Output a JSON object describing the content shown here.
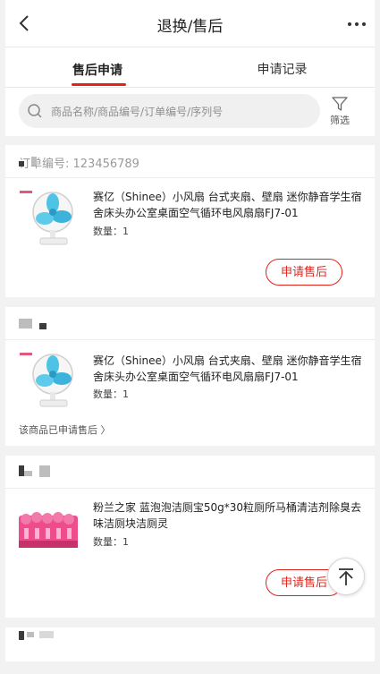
{
  "header": {
    "title": "退换/售后",
    "back_icon": "chevron-left-icon",
    "more_icon": "more-dots-icon"
  },
  "tabs": [
    {
      "label": "售后申请",
      "active": true
    },
    {
      "label": "申请记录",
      "active": false
    }
  ],
  "search": {
    "placeholder": "商品名称/商品编号/订单编号/序列号",
    "filter_label": "筛选"
  },
  "colors": {
    "accent": "#e2231a",
    "background": "#f2f2f2"
  },
  "orders": [
    {
      "order_number": "订单编号: 123456789",
      "products": [
        {
          "name": "赛亿（Shinee）小风扇 台式夹扇、壁扇 迷你静音学生宿舍床头办公室桌面空气循环电风扇扇FJ7-01",
          "quantity": "数量：1",
          "action": "申请售后"
        }
      ]
    },
    {
      "order_number": "",
      "products": [
        {
          "name": "赛亿（Shinee）小风扇 台式夹扇、壁扇 迷你静音学生宿舍床头办公室桌面空气循环电风扇扇FJ7-01",
          "quantity": "数量：1",
          "note": "该商品已申请售后 〉"
        }
      ]
    },
    {
      "order_number": "",
      "products": [
        {
          "name": "粉兰之家 蓝泡泡洁厕宝50g*30粒厕所马桶清洁剂除臭去味洁厕块洁厕灵",
          "quantity": "数量：1",
          "action": "申请售后"
        }
      ]
    },
    {
      "order_number": ""
    }
  ],
  "back_to_top_icon": "arrow-up-icon"
}
